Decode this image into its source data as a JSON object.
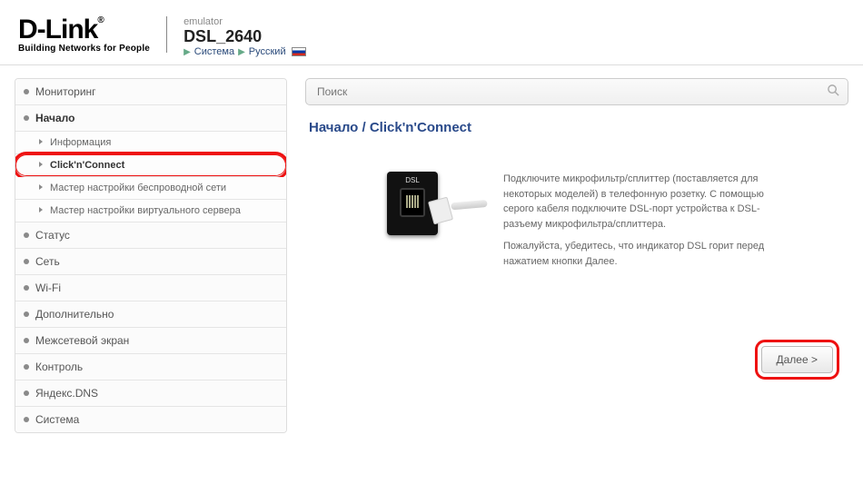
{
  "header": {
    "logo_main": "D-Link",
    "logo_sub": "Building Networks for People",
    "emulator_label": "emulator",
    "model": "DSL_2640",
    "link_system": "Система",
    "link_lang": "Русский"
  },
  "search": {
    "placeholder": "Поиск"
  },
  "sidebar": {
    "items": [
      {
        "label": "Мониторинг",
        "type": "top"
      },
      {
        "label": "Начало",
        "type": "top",
        "expanded": true
      },
      {
        "label": "Информация",
        "type": "sub"
      },
      {
        "label": "Click'n'Connect",
        "type": "sub",
        "active": true
      },
      {
        "label": "Мастер настройки беспроводной сети",
        "type": "sub"
      },
      {
        "label": "Мастер настройки виртуального сервера",
        "type": "sub"
      },
      {
        "label": "Статус",
        "type": "top"
      },
      {
        "label": "Сеть",
        "type": "top"
      },
      {
        "label": "Wi-Fi",
        "type": "top"
      },
      {
        "label": "Дополнительно",
        "type": "top"
      },
      {
        "label": "Межсетевой экран",
        "type": "top"
      },
      {
        "label": "Контроль",
        "type": "top"
      },
      {
        "label": "Яндекс.DNS",
        "type": "top"
      },
      {
        "label": "Система",
        "type": "top"
      }
    ]
  },
  "main": {
    "breadcrumb": "Начало  /   Click'n'Connect",
    "dsl_label": "DSL",
    "para1": "Подключите микрофильтр/сплиттер (поставляется для некоторых моделей) в телефонную розетку. С помощью серого кабеля подключите DSL-порт устройства к DSL-разъему микрофильтра/сплиттера.",
    "para2": "Пожалуйста, убедитесь, что индикатор DSL горит перед нажатием кнопки Далее.",
    "next_label": "Далее >"
  }
}
